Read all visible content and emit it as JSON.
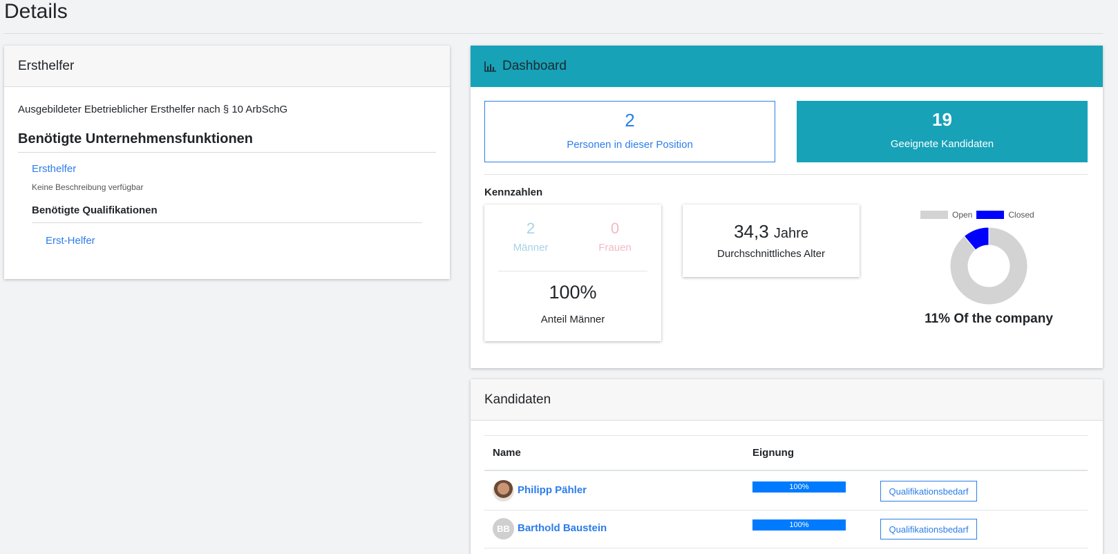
{
  "page": {
    "title": "Details"
  },
  "ersthelfer": {
    "header": "Ersthelfer",
    "description": "Ausgebildeter Ebetrieblicher Ersthelfer nach § 10 ArbSchG",
    "functions_heading": "Benötigte Unternehmensfunktionen",
    "function_link": "Ersthelfer",
    "function_description": "Keine Beschreibung verfügbar",
    "qualifications_heading": "Benötigte Qualifikationen",
    "qualification_link": "Erst-Helfer"
  },
  "dashboard": {
    "header": "Dashboard",
    "icon": "bar-chart-icon",
    "persons": {
      "value": "2",
      "label": "Personen in dieser Position"
    },
    "candidates": {
      "value": "19",
      "label": "Geeignete Kandidaten"
    },
    "kennzahlen_label": "Kennzahlen",
    "gender": {
      "men_value": "2",
      "men_label": "Männer",
      "women_value": "0",
      "women_label": "Frauen",
      "share_value": "100%",
      "share_label": "Anteil Männer"
    },
    "age": {
      "value": "34,3",
      "unit": "Jahre",
      "label": "Durchschnittliches Alter"
    },
    "donut": {
      "legend_open": "Open",
      "legend_closed": "Closed",
      "color_open": "#d3d3d3",
      "color_closed": "#0000ff",
      "closed_fraction": 0.11,
      "caption": "11% Of the company"
    }
  },
  "candidates": {
    "header": "Kandidaten",
    "col_name": "Name",
    "col_fit": "Eignung",
    "rows": [
      {
        "name": "Philipp Pähler",
        "avatar": "photo",
        "fit_label": "100%",
        "fit": 1.0,
        "button": "Qualifikationsbedarf"
      },
      {
        "name": "Barthold Baustein",
        "avatar": "BB",
        "fit_label": "100%",
        "fit": 1.0,
        "button": "Qualifikationsbedarf"
      }
    ]
  }
}
